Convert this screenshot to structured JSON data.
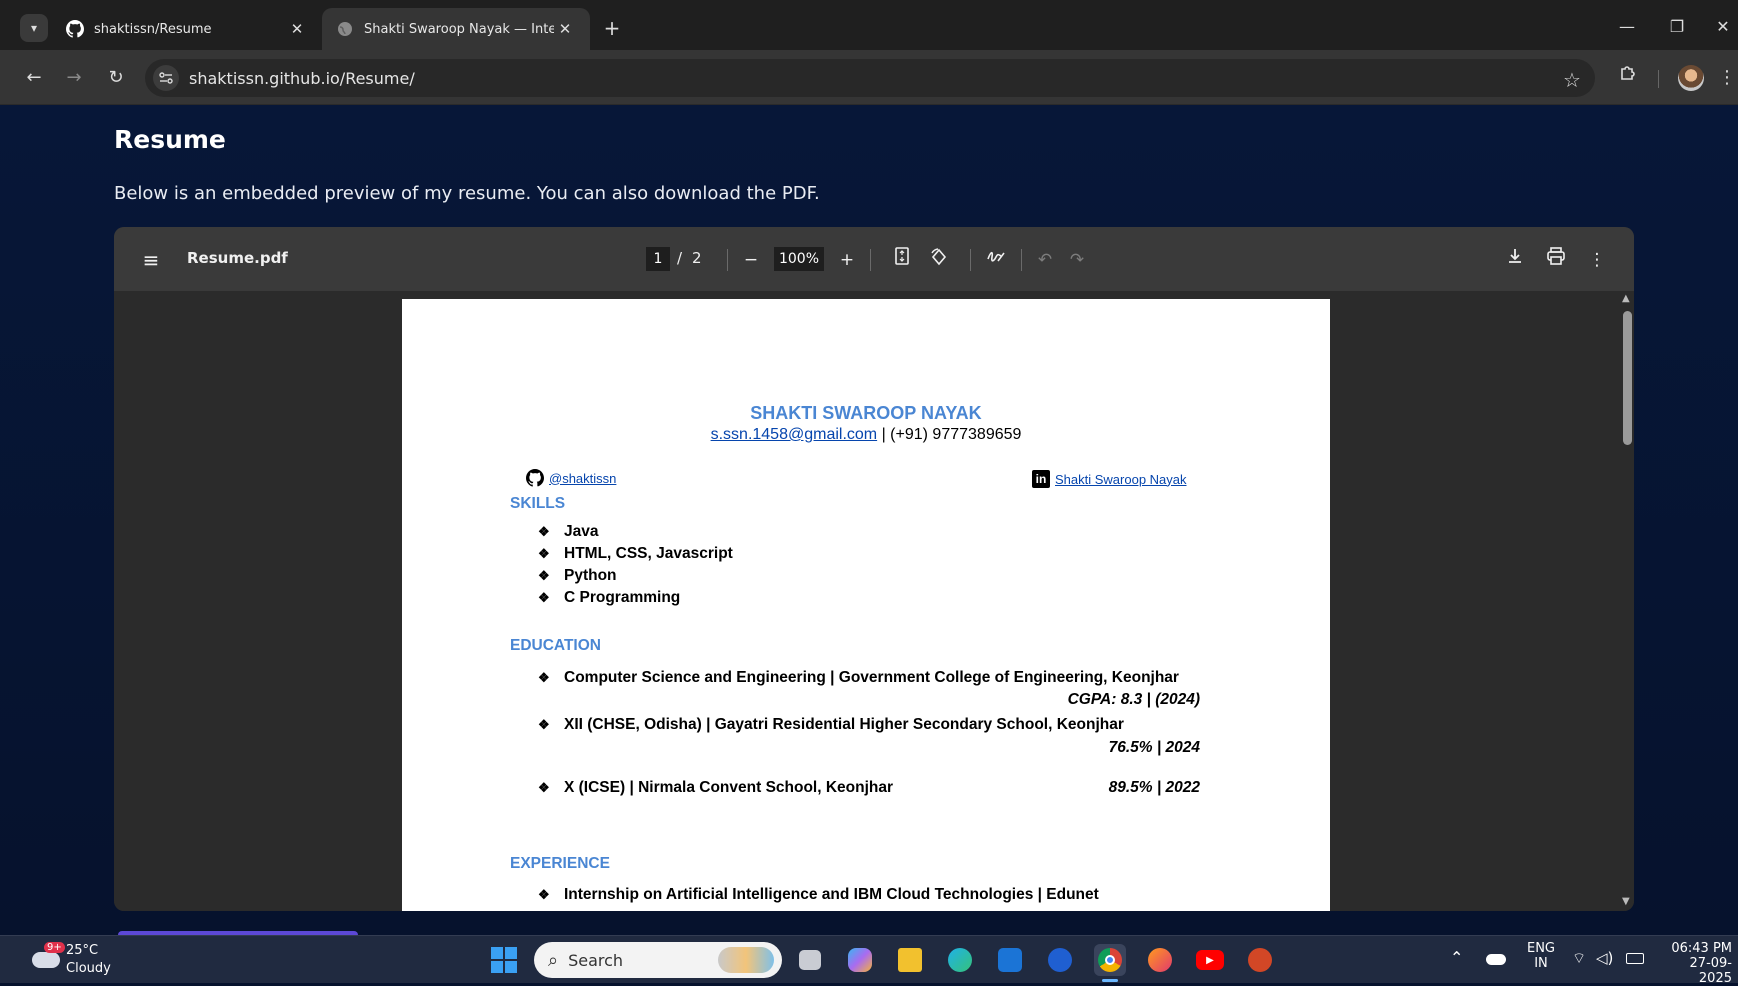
{
  "browser": {
    "tabs": [
      {
        "title": "shaktissn/Resume",
        "icon": "github-icon",
        "active": false
      },
      {
        "title": "Shakti Swaroop Nayak — Intera",
        "icon": "globe-icon",
        "active": true
      }
    ],
    "new_tab_label": "+",
    "url": "shaktissn.github.io/Resume/"
  },
  "page": {
    "title": "Resume",
    "description": "Below is an embedded preview of my resume. You can also download the PDF."
  },
  "pdf_viewer": {
    "filename": "Resume.pdf",
    "current_page": "1",
    "page_sep": "/",
    "total_pages": "2",
    "zoom": "100%",
    "zoom_out": "−",
    "zoom_in": "+"
  },
  "resume": {
    "name": "SHAKTI SWAROOP NAYAK",
    "email": "s.ssn.1458@gmail.com",
    "phone": "| (+91) 9777389659",
    "github": "@shaktissn",
    "linkedin": "Shakti Swaroop Nayak",
    "linkedin_badge": "in",
    "bullet": "❖",
    "skills_heading": "SKILLS",
    "skills": [
      "Java",
      "HTML, CSS, Javascript",
      "Python",
      "C Programming"
    ],
    "education_heading": "EDUCATION",
    "education": [
      {
        "line": "Computer Science and Engineering | Government College of Engineering, Keonjhar",
        "result": "CGPA:  8.3 | (2024)"
      },
      {
        "line": "XII (CHSE, Odisha) | Gayatri Residential Higher Secondary School, Keonjhar",
        "result": "76.5% | 2024"
      },
      {
        "line": "X (ICSE) | Nirmala Convent School, Keonjhar",
        "result": "89.5% | 2022"
      }
    ],
    "experience_heading": "EXPERIENCE",
    "experience": [
      "Internship on Artificial Intelligence and IBM Cloud Technologies | Edunet"
    ]
  },
  "taskbar": {
    "weather_temp": "25°C",
    "weather_cond": "Cloudy",
    "weather_badge": "9+",
    "search_placeholder": "Search",
    "lang_top": "ENG",
    "lang_bottom": "IN",
    "time": "06:43 PM",
    "date": "27-09-2025"
  },
  "colors": {
    "accent_heading": "#4a86d3",
    "link": "#0645ad",
    "page_bg": "#06122d"
  }
}
